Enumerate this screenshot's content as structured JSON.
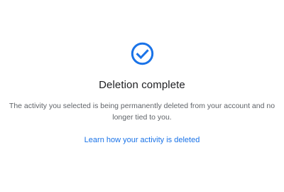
{
  "status": {
    "icon": "check-circle-icon",
    "accent_color": "#1a73e8",
    "title": "Deletion complete",
    "description": "The activity you selected is being permanently deleted from your account and no longer tied to you."
  },
  "link": {
    "label": "Learn how your activity is deleted"
  }
}
